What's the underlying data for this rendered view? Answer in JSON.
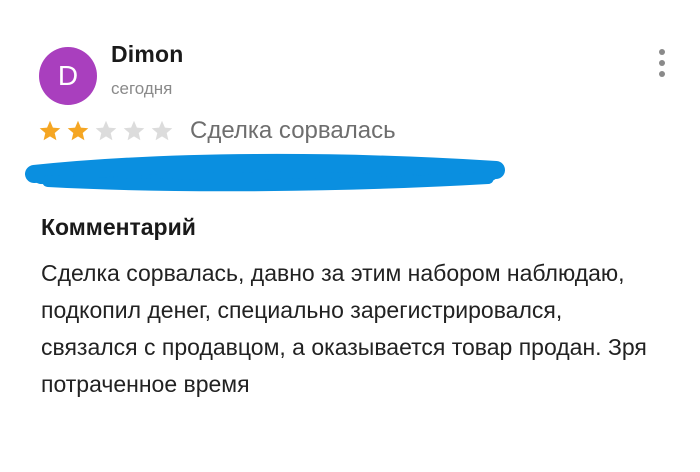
{
  "review": {
    "author": {
      "initial": "D",
      "name": "Dimon",
      "avatar_color": "#a93fbe"
    },
    "date": "сегодня",
    "rating": {
      "value": 2,
      "max": 5,
      "filled_color": "#f5a623",
      "empty_color": "#dcdcdc"
    },
    "deal_status": "Сделка сорвалась",
    "redaction_color": "#0a8fe0",
    "comment": {
      "heading": "Комментарий",
      "text": "Сделка сорвалась, давно за этим набором наблюдаю, подкопил денег, специально зарегистрировался, связался с продавцом, а оказывается товар продан. Зря потраченное время"
    },
    "menu_icon": "more-vertical-icon"
  }
}
